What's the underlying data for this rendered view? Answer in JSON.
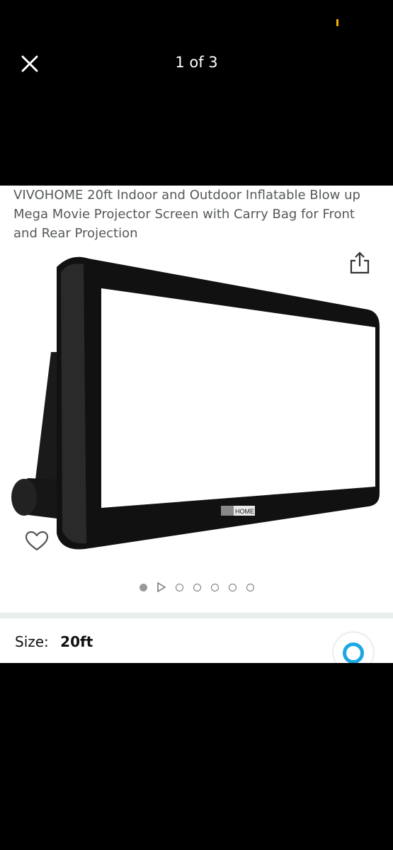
{
  "header": {
    "counter": "1 of 3"
  },
  "product": {
    "title": "VIVOHOME 20ft Indoor and Outdoor Inflatable Blow up Mega Movie Projector Screen with Carry Bag for Front and Rear Projection",
    "brand_badge": "HOME"
  },
  "icons": {
    "close": "close-icon",
    "share": "share-icon",
    "wishlist": "heart-outline-icon",
    "alexa": "alexa-icon"
  },
  "carousel": {
    "items": [
      "image",
      "video",
      "image",
      "image",
      "image",
      "image",
      "image"
    ],
    "active_index": 0
  },
  "options": {
    "size_label": "Size:",
    "size_value": "20ft"
  },
  "colors": {
    "accent": "#1aa7e3",
    "status": "#f3b300"
  }
}
